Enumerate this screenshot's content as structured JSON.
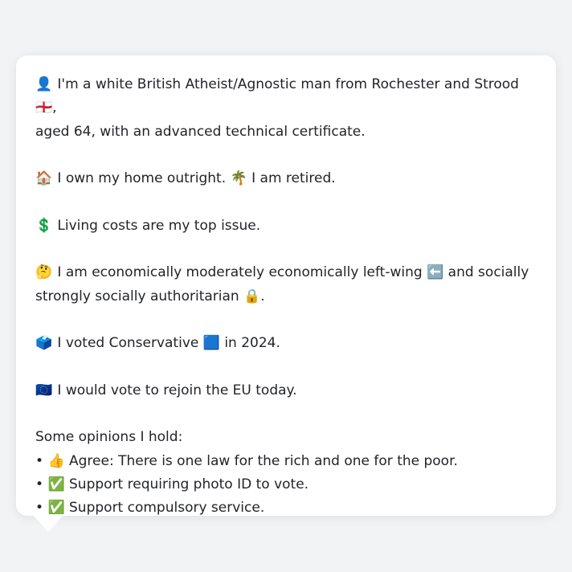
{
  "profile": {
    "identity_icon": "👤",
    "identity_text": "I'm a white British Atheist/Agnostic man from Rochester and Strood",
    "flag_icon": "🏴󠁧󠁢󠁥󠁮󠁧󠁿",
    "identity_text_end": ",",
    "identity_text_line2": "aged 64, with an advanced technical certificate.",
    "home_icon": "🏠",
    "home_text": "I own my home outright.",
    "retired_icon": "🌴",
    "retired_text": "I am retired.",
    "issue_icon": "💲",
    "issue_text": "Living costs are my top issue.",
    "politics_icon": "🤔",
    "politics_text_a": "I am economically moderately economically left-wing",
    "left_icon": "⬅️",
    "politics_text_b": "and socially",
    "politics_text_line2": "strongly socially authoritarian",
    "lock_icon": "🔒",
    "politics_text_end": ".",
    "vote_icon": "🗳️",
    "vote_text_a": "I voted Conservative",
    "party_icon": "🟦",
    "vote_text_b": "in 2024.",
    "eu_icon": "🇪🇺",
    "eu_text": "I would vote to rejoin the EU today.",
    "opinions_heading": "Some opinions I hold:",
    "opinions": [
      {
        "bullet": "•",
        "icon": "👍",
        "text": "Agree: There is one law for the rich and one for the poor."
      },
      {
        "bullet": "•",
        "icon": "✅",
        "text": "Support requiring photo ID to vote."
      },
      {
        "bullet": "•",
        "icon": "✅",
        "text": "Support compulsory service."
      }
    ]
  },
  "colors": {
    "background": "#f2f3f5",
    "bubble": "#ffffff",
    "text": "#222428"
  }
}
